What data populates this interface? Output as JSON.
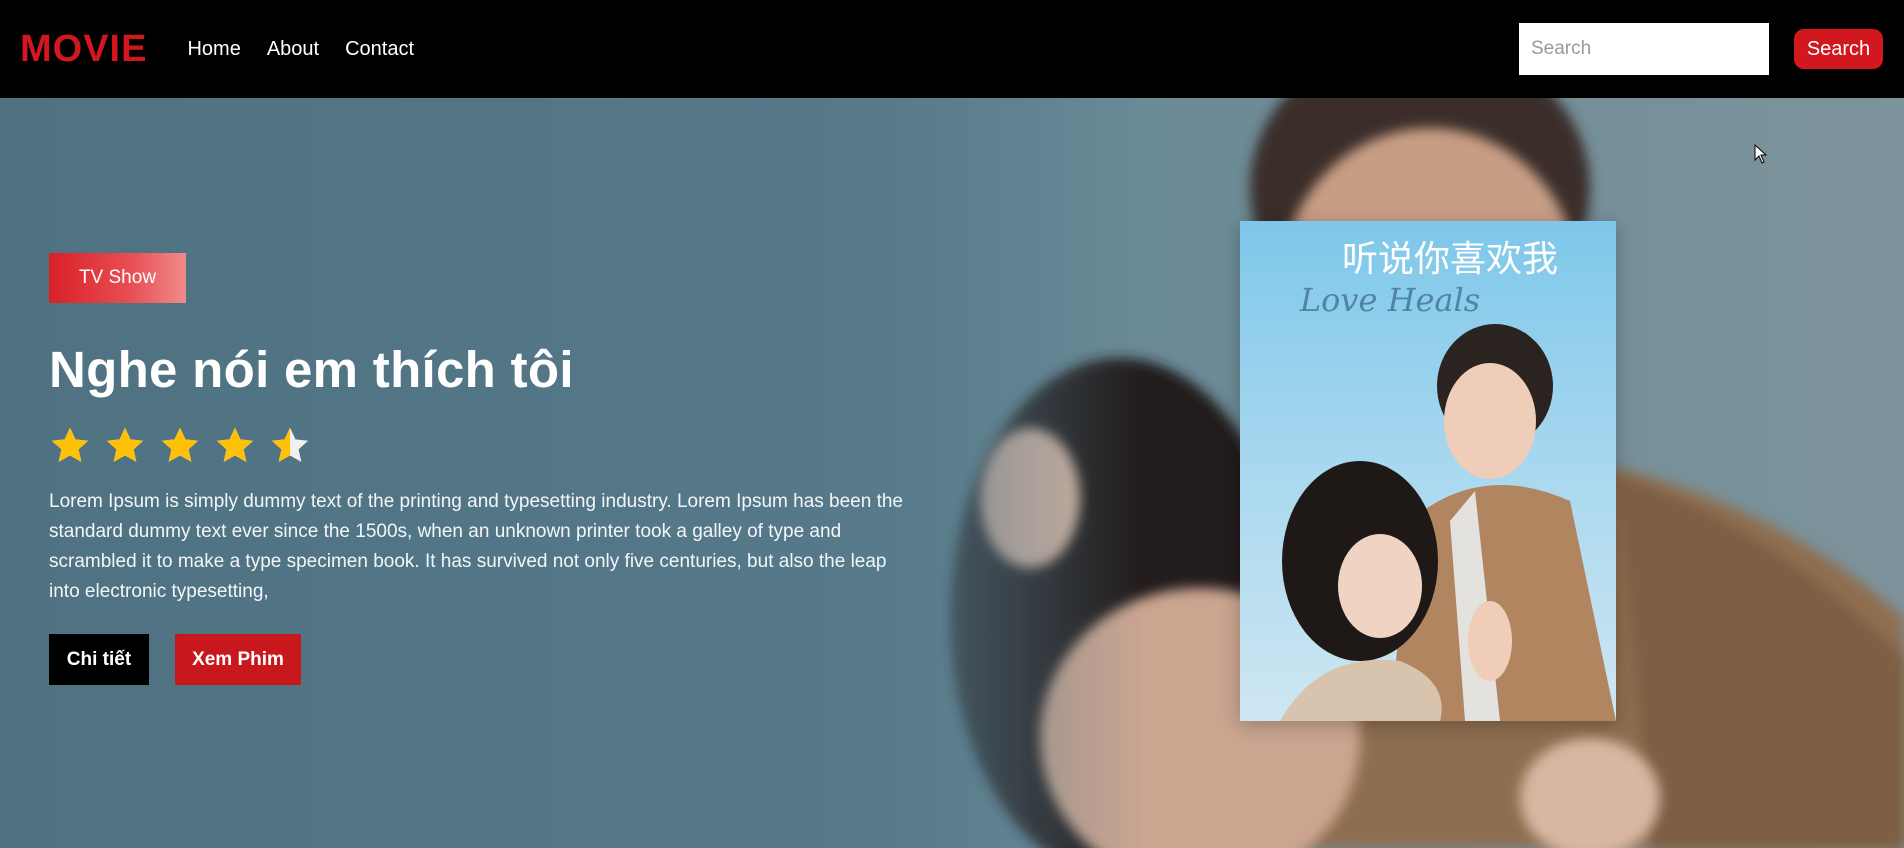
{
  "navbar": {
    "logo": "MOVIE",
    "links": [
      "Home",
      "About",
      "Contact"
    ],
    "search_placeholder": "Search",
    "search_button": "Search"
  },
  "hero": {
    "tag": "TV Show",
    "title": "Nghe nói em thích tôi",
    "rating": 4.5,
    "rating_max": 5,
    "description": "Lorem Ipsum is simply dummy text of the printing and typesetting industry. Lorem Ipsum has been the standard dummy text ever since the 1500s, when an unknown printer took a galley of type and scrambled it to make a type specimen book. It has survived not only five centuries, but also the leap into electronic typesetting,",
    "detail_button": "Chi tiết",
    "watch_button": "Xem Phim",
    "poster_title": "听说你喜欢我",
    "poster_script": "Love Heals"
  },
  "colors": {
    "brand_red": "#d2181e",
    "star_gold": "#ffc107",
    "navbar_bg": "#000000"
  }
}
